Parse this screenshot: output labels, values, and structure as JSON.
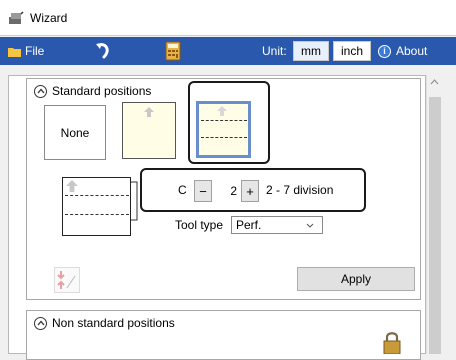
{
  "window": {
    "title": "Wizard"
  },
  "toolbar": {
    "file_label": "File",
    "unit_label": "Unit:",
    "unit_mm": "mm",
    "unit_inch": "inch",
    "about_label": "About"
  },
  "standard": {
    "heading": "Standard positions",
    "none_label": "None"
  },
  "stepper": {
    "prefix": "C",
    "minus": "−",
    "value": "2",
    "plus": "+",
    "range": "2 - 7 division"
  },
  "tool": {
    "label": "Tool type",
    "value": "Perf."
  },
  "apply_label": "Apply",
  "nonstandard": {
    "heading": "Non standard positions"
  },
  "colors": {
    "toolbar_bg": "#2a58ac",
    "sheet_yellow": "#fffde6",
    "highlight": "#1a1a1a"
  }
}
